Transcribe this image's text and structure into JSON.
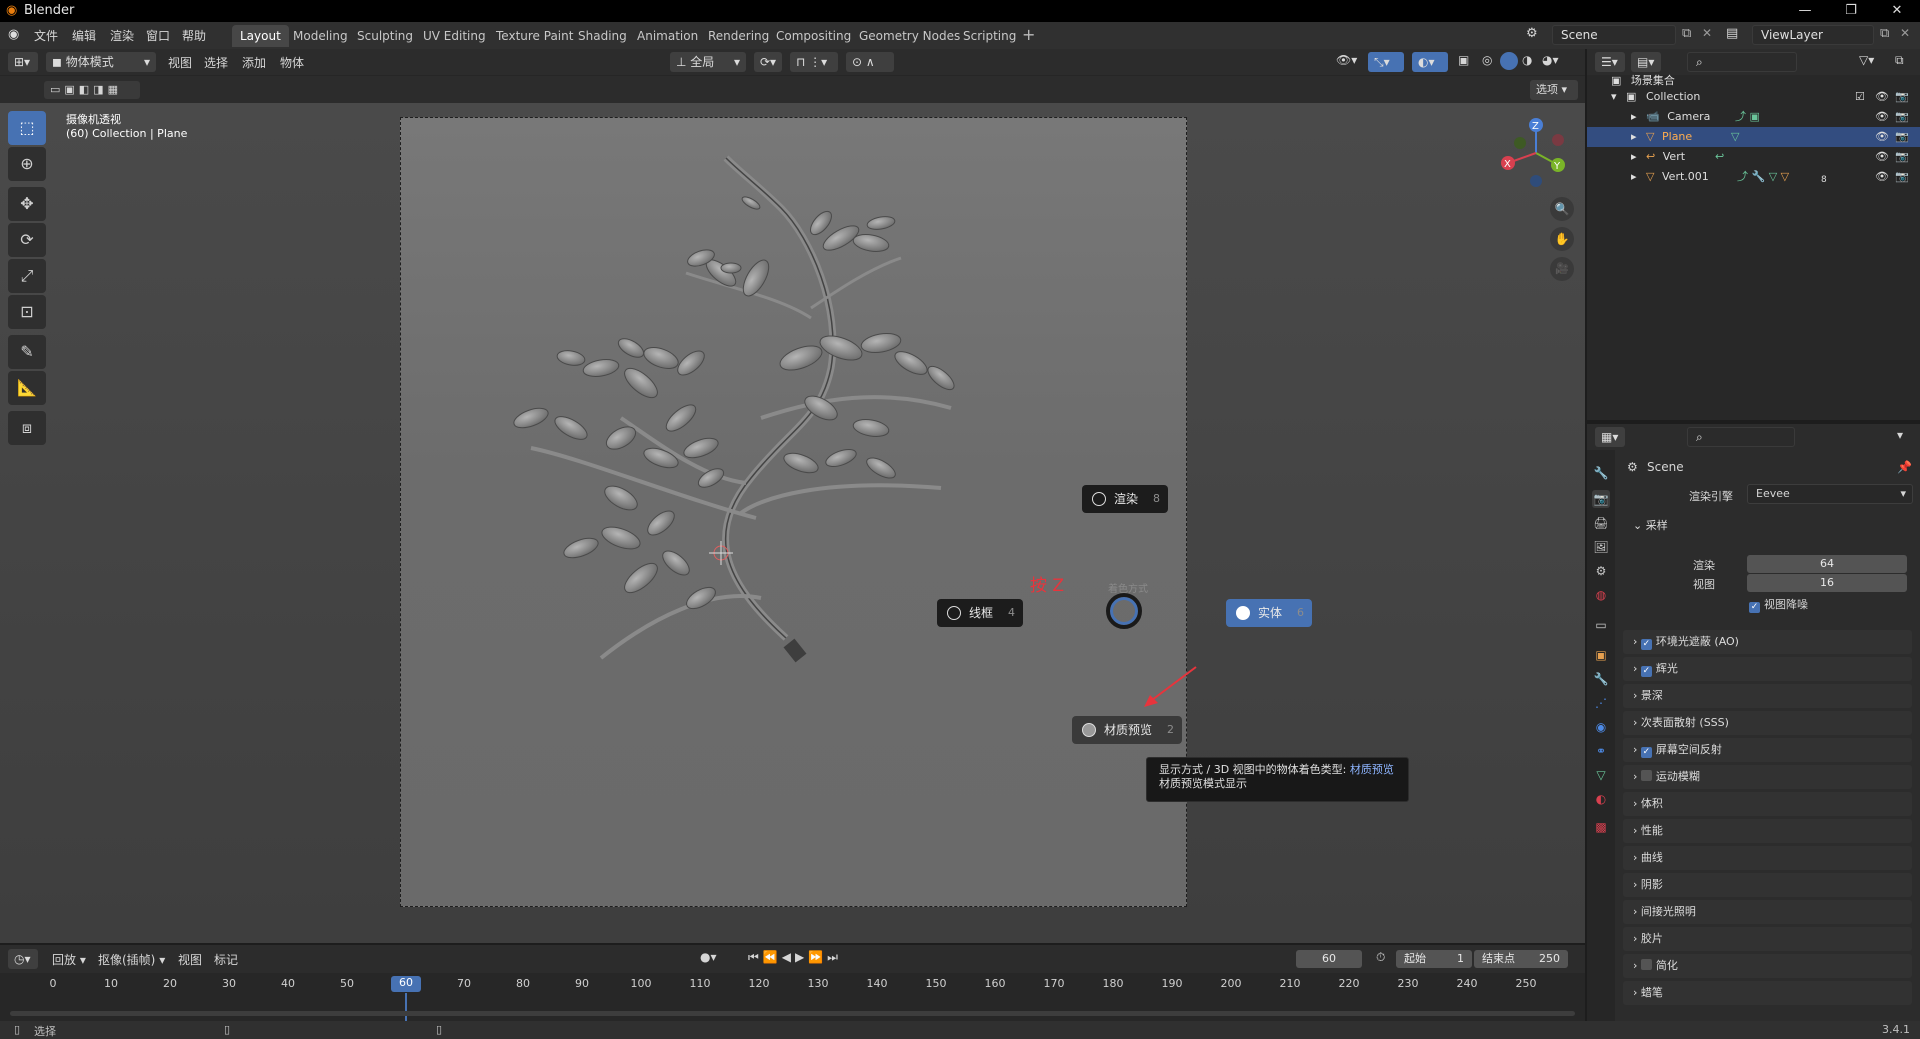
{
  "app": {
    "title": "Blender"
  },
  "menu": {
    "items": [
      "文件",
      "编辑",
      "渲染",
      "窗口",
      "帮助"
    ]
  },
  "workspaces": [
    "Layout",
    "Modeling",
    "Sculpting",
    "UV Editing",
    "Texture Paint",
    "Shading",
    "Animation",
    "Rendering",
    "Compositing",
    "Geometry Nodes",
    "Scripting"
  ],
  "scene": {
    "name": "Scene",
    "view_layer": "ViewLayer"
  },
  "vp_header": {
    "mode": "物体模式",
    "menus": [
      "视图",
      "选择",
      "添加",
      "物体"
    ],
    "transform": "全局",
    "options": "选项"
  },
  "viewport": {
    "view_name": "摄像机透视",
    "info": "(60) Collection | Plane"
  },
  "gizmo": {
    "x": "X",
    "y": "Y",
    "z": "Z"
  },
  "pie": {
    "title": "着色方式",
    "render": {
      "label": "渲染",
      "key": "8"
    },
    "wire": {
      "label": "线框",
      "key": "4"
    },
    "solid": {
      "label": "实体",
      "key": "6"
    },
    "material": {
      "label": "材质预览",
      "key": "2"
    },
    "annotation": "按 Z"
  },
  "tooltip": {
    "line1": "显示方式 / 3D 视图中的物体着色类型: ",
    "highlight": "材质预览",
    "line2": "材质预览模式显示"
  },
  "timeline": {
    "menus": [
      "回放",
      "抠像(插帧)",
      "视图",
      "标记"
    ],
    "current_frame": "60",
    "start_label": "起始",
    "start": "1",
    "end_label": "结束点",
    "end": "250",
    "ticks": [
      "0",
      "10",
      "20",
      "30",
      "40",
      "50",
      "60",
      "70",
      "80",
      "90",
      "100",
      "110",
      "120",
      "130",
      "140",
      "150",
      "160",
      "170",
      "180",
      "190",
      "200",
      "210",
      "220",
      "230",
      "240",
      "250"
    ]
  },
  "status": {
    "select": "选择",
    "version": "3.4.1"
  },
  "outliner": {
    "root": "场景集合",
    "collection": "Collection",
    "items": [
      {
        "name": "Camera",
        "selected": false
      },
      {
        "name": "Plane",
        "selected": true
      },
      {
        "name": "Vert",
        "selected": false
      },
      {
        "name": "Vert.001",
        "selected": false
      }
    ],
    "vert001_badge": "8"
  },
  "properties": {
    "scene_name": "Scene",
    "engine_label": "渲染引擎",
    "engine": "Eevee",
    "sampling": "采样",
    "render_label": "渲染",
    "render_samples": "64",
    "viewport_label": "视图",
    "viewport_samples": "16",
    "denoise": "视图降噪",
    "panels": [
      {
        "label": "环境光遮蔽 (AO)",
        "check": true
      },
      {
        "label": "辉光",
        "check": true
      },
      {
        "label": "景深",
        "check": null
      },
      {
        "label": "次表面散射 (SSS)",
        "check": null
      },
      {
        "label": "屏幕空间反射",
        "check": true
      },
      {
        "label": "运动模糊",
        "check": false
      },
      {
        "label": "体积",
        "check": null
      },
      {
        "label": "性能",
        "check": null
      },
      {
        "label": "曲线",
        "check": null
      },
      {
        "label": "阴影",
        "check": null
      },
      {
        "label": "间接光照明",
        "check": null
      },
      {
        "label": "胶片",
        "check": null
      },
      {
        "label": "简化",
        "check": false
      },
      {
        "label": "蜡笔",
        "check": null
      }
    ]
  }
}
